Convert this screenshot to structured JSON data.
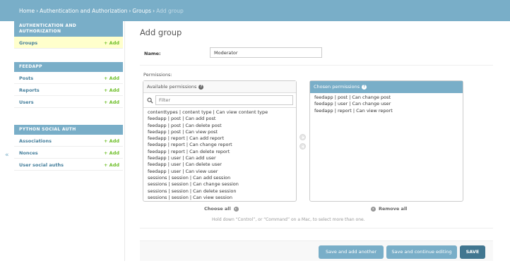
{
  "breadcrumbs": {
    "home": "Home",
    "app": "Authentication and Authorization",
    "model": "Groups",
    "current": "Add group",
    "separator": "›"
  },
  "sidebar": {
    "collapse_label": "«",
    "modules": [
      {
        "caption": "AUTHENTICATION AND AUTHORIZATION",
        "items": [
          {
            "label": "Groups",
            "add_label": "+ Add",
            "selected": true
          }
        ]
      },
      {
        "caption": "FEEDAPP",
        "items": [
          {
            "label": "Posts",
            "add_label": "+ Add"
          },
          {
            "label": "Reports",
            "add_label": "+ Add"
          },
          {
            "label": "Users",
            "add_label": "+ Add"
          }
        ]
      },
      {
        "caption": "PYTHON SOCIAL AUTH",
        "items": [
          {
            "label": "Associations",
            "add_label": "+ Add"
          },
          {
            "label": "Nonces",
            "add_label": "+ Add"
          },
          {
            "label": "User social auths",
            "add_label": "+ Add"
          }
        ]
      }
    ]
  },
  "form": {
    "title": "Add group",
    "name_label": "Name:",
    "name_value": "Moderator",
    "permissions_label": "Permissions:",
    "available": {
      "title": "Available permissions",
      "help_icon": "?",
      "filter_placeholder": "Filter",
      "options": [
        "contenttypes | content type | Can view content type",
        "feedapp | post | Can add post",
        "feedapp | post | Can delete post",
        "feedapp | post | Can view post",
        "feedapp | report | Can add report",
        "feedapp | report | Can change report",
        "feedapp | report | Can delete report",
        "feedapp | user | Can add user",
        "feedapp | user | Can delete user",
        "feedapp | user | Can view user",
        "sessions | session | Can add session",
        "sessions | session | Can change session",
        "sessions | session | Can delete session",
        "sessions | session | Can view session"
      ]
    },
    "chosen": {
      "title": "Chosen permissions",
      "help_icon": "?",
      "options": [
        "feedapp | post | Can change post",
        "feedapp | user | Can change user",
        "feedapp | report | Can view report"
      ]
    },
    "choose_all_label": "Choose all",
    "remove_all_label": "Remove all",
    "help_text": "Hold down “Control”, or “Command” on a Mac, to select more than one."
  },
  "submit": {
    "save_add_another": "Save and add another",
    "save_continue": "Save and continue editing",
    "save": "SAVE"
  }
}
